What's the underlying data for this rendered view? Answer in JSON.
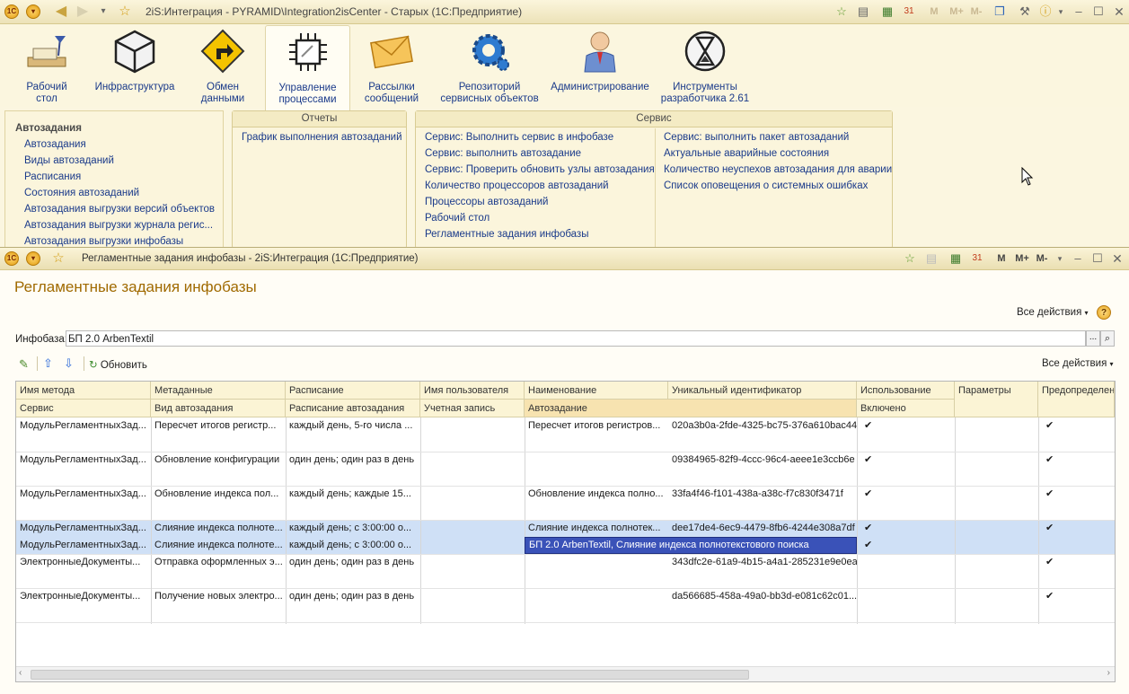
{
  "app": {
    "title": "2iS:Интеграция - PYRAMID\\Integration2isCenter - Старых  (1С:Предприятие)",
    "toolbar_letters": [
      "M",
      "M+",
      "M-"
    ]
  },
  "sections": [
    {
      "label": "Рабочий\nстол",
      "icon": "desk-lamp-icon"
    },
    {
      "label": "Инфраструктура",
      "icon": "cube-icon"
    },
    {
      "label": "Обмен\nданными",
      "icon": "arrow-sign-icon"
    },
    {
      "label": "Управление\nпроцессами",
      "icon": "chip-icon"
    },
    {
      "label": "Рассылки\nсообщений",
      "icon": "envelope-icon"
    },
    {
      "label": "Репозиторий\nсервисных объектов",
      "icon": "gears-icon"
    },
    {
      "label": "Администрирование",
      "icon": "user-icon"
    },
    {
      "label": "Инструменты\nразработчика 2.61",
      "icon": "hourglass-icon"
    }
  ],
  "nav": {
    "heading": "Автозадания",
    "items": [
      "Автозадания",
      "Виды автозаданий",
      "Расписания",
      "Состояния автозаданий",
      "Автозадания выгрузки версий объектов",
      "Автозадания выгрузки журнала регис...",
      "Автозадания выгрузки инфобазы"
    ]
  },
  "reports": {
    "title": "Отчеты",
    "items": [
      "График выполнения автозаданий"
    ]
  },
  "service": {
    "title": "Сервис",
    "col1": [
      "Сервис:  Выполнить сервис в инфобазе",
      "Сервис: выполнить автозадание",
      "Сервис: Проверить обновить узлы автозадания",
      "Количество процессоров автозаданий",
      "Процессоры автозаданий",
      "Рабочий стол",
      "Регламентные задания инфобазы"
    ],
    "col2": [
      "Сервис: выполнить пакет автозаданий",
      "Актуальные аварийные состояния",
      "Количество неуспехов автозадания для аварии",
      "Список оповещения о системных ошибках"
    ]
  },
  "subwindow": {
    "title": "Регламентные задания инфобазы - 2iS:Интеграция  (1С:Предприятие)",
    "form_title": "Регламентные задания инфобазы",
    "all_actions": "Все действия",
    "infobase_label": "Инфобаза:",
    "infobase_value": "БП 2.0 ArbenTextil",
    "refresh_label": "Обновить"
  },
  "table": {
    "header1": [
      "Имя метода",
      "Метаданные",
      "Расписание",
      "Имя пользователя",
      "Наименование",
      "Уникальный идентификатор",
      "Использование",
      "Параметры",
      "Предопределен"
    ],
    "header2": [
      "Сервис",
      "Вид автозадания",
      "Расписание автозадания",
      "Учетная запись",
      "Автозадание",
      "",
      "Включено",
      "",
      ""
    ],
    "rows": [
      {
        "c": [
          "МодульРегламентныхЗад...",
          "Пересчет итогов регистр...",
          "каждый день, 5-го числа ...",
          "",
          "Пересчет итогов регистров...",
          "020a3b0a-2fde-4325-bc75-376a610bac44",
          "✔",
          "",
          "✔"
        ]
      },
      {
        "c": [
          "МодульРегламентныхЗад...",
          "Обновление конфигурации",
          "один день; один раз в день",
          "",
          "",
          "09384965-82f9-4ccc-96c4-aeee1e3ccb6e",
          "✔",
          "",
          "✔"
        ]
      },
      {
        "c": [
          "МодульРегламентныхЗад...",
          "Обновление индекса пол...",
          "каждый день; каждые 15...",
          "",
          "Обновление индекса полно...",
          "33fa4f46-f101-438a-a38c-f7c830f3471f",
          "✔",
          "",
          "✔"
        ]
      },
      {
        "c": [
          "МодульРегламентныхЗад...",
          "Слияние индекса полноте...",
          "каждый день; с 3:00:00 о...",
          "",
          "Слияние индекса полнотек...",
          "dee17de4-6ec9-4479-8fb6-4244e308a7df",
          "✔",
          "",
          "✔"
        ],
        "sub": [
          "МодульРегламентныхЗад...",
          "Слияние индекса полноте...",
          "каждый день; с 3:00:00 о...",
          "",
          "БП 2.0 ArbenTextil, Слияние индекса полнотекстового поиска",
          "✔"
        ]
      },
      {
        "c": [
          "ЭлектронныеДокументы...",
          "Отправка оформленных э...",
          "один день; один раз в день",
          "",
          "",
          "343dfc2e-61a9-4b15-a4a1-285231e9e0ea",
          "",
          "",
          "✔"
        ]
      },
      {
        "c": [
          "ЭлектронныеДокументы...",
          "Получение новых электро...",
          "один день; один раз в день",
          "",
          "",
          "da566685-458a-49a0-bb3d-e081c62c01...",
          "",
          "",
          "✔"
        ]
      }
    ]
  },
  "colors": {
    "accent": "#a06a00",
    "link": "#1a3a8a",
    "selection": "#cfe0f6",
    "active_cell": "#3a52b8"
  }
}
